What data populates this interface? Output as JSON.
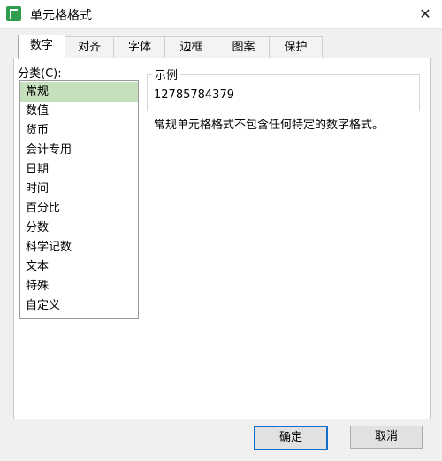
{
  "window": {
    "title": "单元格格式",
    "icon": "spreadsheet-app-icon",
    "close_glyph": "✕",
    "accent": "#2f9e4f"
  },
  "tabs": [
    {
      "label": "数字",
      "active": true
    },
    {
      "label": "对齐"
    },
    {
      "label": "字体"
    },
    {
      "label": "边框"
    },
    {
      "label": "图案"
    },
    {
      "label": "保护"
    }
  ],
  "category": {
    "label": "分类(C):",
    "items": [
      "常规",
      "数值",
      "货币",
      "会计专用",
      "日期",
      "时间",
      "百分比",
      "分数",
      "科学记数",
      "文本",
      "特殊",
      "自定义"
    ],
    "selected": "常规"
  },
  "sample": {
    "legend": "示例",
    "value": "12785784379"
  },
  "description": "常规单元格格式不包含任何特定的数字格式。",
  "buttons": {
    "ok": "确定",
    "cancel": "取消"
  }
}
